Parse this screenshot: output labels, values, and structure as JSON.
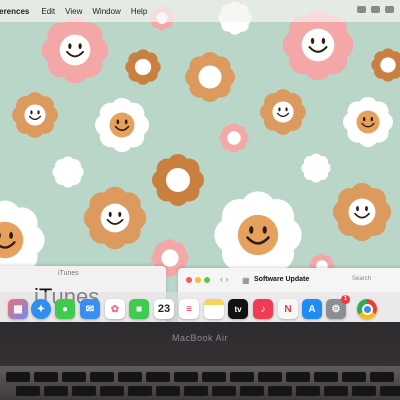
{
  "menubar": {
    "app_name": "eferences",
    "items": [
      "Edit",
      "View",
      "Window",
      "Help"
    ]
  },
  "windows": {
    "itunes": {
      "title": "iTunes",
      "big_label": "iTunes"
    },
    "software_update": {
      "nav": "‹  ›",
      "grid": "▦",
      "title": "Software Update",
      "search": "Search"
    }
  },
  "dock": {
    "apps": [
      "Launchpad",
      "Safari",
      "Messages",
      "Mail",
      "Photos",
      "FaceTime",
      "Calendar",
      "Reminders",
      "Notes",
      "Apple TV",
      "Music",
      "News",
      "App Store",
      "System Preferences",
      "Chrome"
    ],
    "calendar_day": "23",
    "appletv_label": "tv",
    "prefs_badge": "1"
  },
  "device": {
    "brand": "MacBook Air"
  },
  "colors": {
    "wallpaper": "#b9d6c8",
    "pink": "#f3a7a7",
    "orange": "#dc9a5e",
    "brown": "#c97f3f",
    "white_petal": "#ffffff",
    "face": "#e7a15e"
  }
}
